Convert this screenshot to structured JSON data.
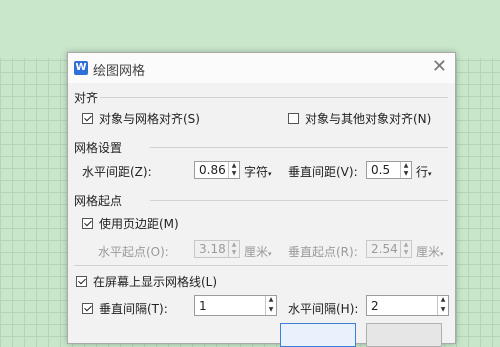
{
  "dialog": {
    "title": "绘图网格",
    "app_icon_letter": "W",
    "close_glyph": "✕"
  },
  "align": {
    "header": "对齐",
    "snap_to_grid": {
      "label": "对象与网格对齐(S)",
      "checked": true
    },
    "snap_to_objects": {
      "label": "对象与其他对象对齐(N)",
      "checked": false
    }
  },
  "grid_settings": {
    "header": "网格设置",
    "horizontal_spacing": {
      "label": "水平间距(Z):",
      "value": "0.86",
      "unit": "字符"
    },
    "vertical_spacing": {
      "label": "垂直间距(V):",
      "value": "0.5",
      "unit": "行"
    }
  },
  "grid_origin": {
    "header": "网格起点",
    "use_margins": {
      "label": "使用页边距(M)",
      "checked": true
    },
    "horizontal_origin": {
      "label": "水平起点(O):",
      "value": "3.18",
      "unit": "厘米"
    },
    "vertical_origin": {
      "label": "垂直起点(R):",
      "value": "2.54",
      "unit": "厘米"
    }
  },
  "display": {
    "show_gridlines": {
      "label": "在屏幕上显示网格线(L)",
      "checked": true
    },
    "vertical_every": {
      "label": "垂直间隔(T):",
      "value": "1",
      "checked": true
    },
    "horizontal_every": {
      "label": "水平间隔(H):",
      "value": "2"
    }
  },
  "colors": {
    "accent": "#2f6fd8",
    "dialog_bg": "#f2f2f2",
    "grid_bg": "#c8e6c9"
  }
}
